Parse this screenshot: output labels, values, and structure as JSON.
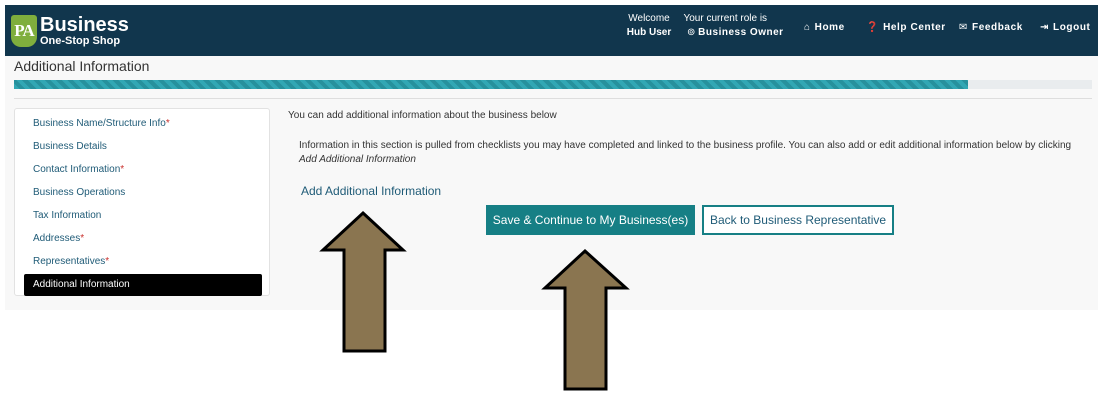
{
  "header": {
    "logo_badge": "PA",
    "logo_line1": "Business",
    "logo_line2": "One-Stop Shop",
    "welcome_label": "Welcome",
    "welcome_user": "Hub User",
    "role_label": "Your current role is",
    "role_value": "Business Owner",
    "nav": [
      {
        "label": "Home",
        "icon": "home-icon",
        "glyph": "⌂"
      },
      {
        "label": "Help Center",
        "icon": "question-circle-icon",
        "glyph": "❓"
      },
      {
        "label": "Feedback",
        "icon": "speech-bubble-icon",
        "glyph": "💬"
      },
      {
        "label": "Logout",
        "icon": "logout-icon",
        "glyph": "⇥"
      }
    ],
    "background_color": "#11364d"
  },
  "page_title": "Additional Information",
  "progress": {
    "percent": 88.5,
    "color": "#32a7b4"
  },
  "sidebar": {
    "items": [
      {
        "label": "Business Name/Structure Info",
        "required": true,
        "active": false
      },
      {
        "label": "Business Details",
        "required": false,
        "active": false
      },
      {
        "label": "Contact Information",
        "required": true,
        "active": false
      },
      {
        "label": "Business Operations",
        "required": false,
        "active": false
      },
      {
        "label": "Tax Information",
        "required": false,
        "active": false
      },
      {
        "label": "Addresses",
        "required": true,
        "active": false
      },
      {
        "label": "Representatives",
        "required": true,
        "active": false
      },
      {
        "label": "Additional Information",
        "required": false,
        "active": true
      }
    ],
    "required_marker": "*"
  },
  "main": {
    "intro": "You can add additional information about the business below",
    "info_text": "Information in this section is pulled from checklists you may have completed and linked to the business profile. You can also add or edit additional information below by clicking ",
    "info_emphasis": "Add Additional Information",
    "add_link": "Add Additional Information",
    "save_button": "Save & Continue to My Business(es)",
    "back_button": "Back to Business Representative",
    "accent_color": "#167f85"
  },
  "annotations": {
    "arrow_color": "#8a7550"
  }
}
